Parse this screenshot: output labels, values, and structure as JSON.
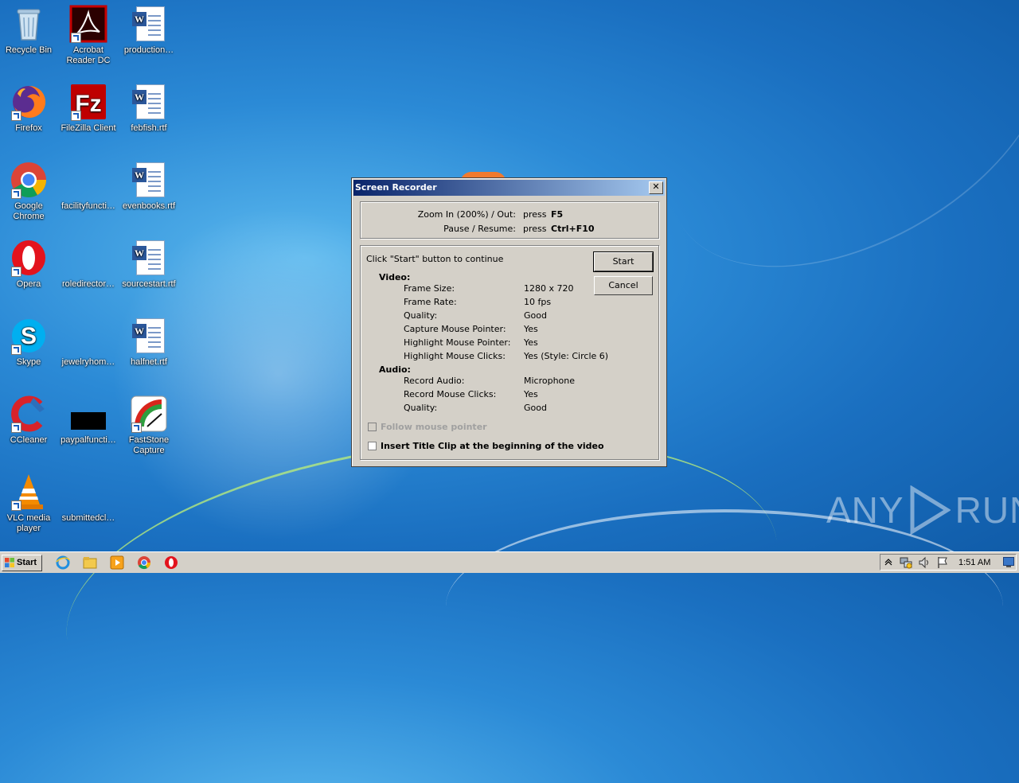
{
  "desktop": {
    "icons": [
      {
        "label": "Recycle Bin"
      },
      {
        "label": "Acrobat Reader DC"
      },
      {
        "label": "production…"
      },
      {
        "label": "Firefox"
      },
      {
        "label": "FileZilla Client"
      },
      {
        "label": "febfish.rtf"
      },
      {
        "label": "Google Chrome"
      },
      {
        "label": "facilityfuncti…"
      },
      {
        "label": "evenbooks.rtf"
      },
      {
        "label": "Opera"
      },
      {
        "label": "roledirector…"
      },
      {
        "label": "sourcestart.rtf"
      },
      {
        "label": "Skype"
      },
      {
        "label": "jewelryhom…"
      },
      {
        "label": "halfnet.rtf"
      },
      {
        "label": "CCleaner"
      },
      {
        "label": "paypalfuncti…"
      },
      {
        "label": "FastStone Capture"
      },
      {
        "label": "VLC media player"
      },
      {
        "label": "submittedcl…"
      }
    ],
    "watermark": {
      "left": "ANY",
      "right": "RUN"
    }
  },
  "dialog": {
    "title": "Screen Recorder",
    "close_label": "✕",
    "hotkeys": [
      {
        "label": "Zoom In (200%) / Out:",
        "press": "press",
        "key": "F5"
      },
      {
        "label": "Pause / Resume:",
        "press": "press",
        "key": "Ctrl+F10"
      }
    ],
    "instruction": "Click \"Start\" button to continue",
    "start_label": "Start",
    "cancel_label": "Cancel",
    "video_header": "Video:",
    "video": [
      {
        "name": "Frame Size:",
        "value": "1280 x 720"
      },
      {
        "name": "Frame Rate:",
        "value": "10 fps"
      },
      {
        "name": "Quality:",
        "value": "Good"
      },
      {
        "name": "Capture Mouse Pointer:",
        "value": "Yes"
      },
      {
        "name": "Highlight Mouse Pointer:",
        "value": "Yes"
      },
      {
        "name": "Highlight Mouse Clicks:",
        "value": "Yes (Style: Circle 6)"
      }
    ],
    "audio_header": "Audio:",
    "audio": [
      {
        "name": "Record Audio:",
        "value": "Microphone"
      },
      {
        "name": "Record Mouse Clicks:",
        "value": "Yes"
      },
      {
        "name": "Quality:",
        "value": "Good"
      }
    ],
    "follow_pointer_label": "Follow mouse pointer",
    "follow_pointer_checked": false,
    "follow_pointer_enabled": false,
    "title_clip_label": "Insert Title Clip at the beginning of the video",
    "title_clip_checked": false
  },
  "taskbar": {
    "start_label": "Start",
    "clock": "1:51 AM"
  },
  "colors": {
    "titlebar_start": "#0a246a",
    "titlebar_end": "#a6caf0",
    "dialog_face": "#d4d0c8",
    "desktop_blue": "#1a6fc0"
  }
}
